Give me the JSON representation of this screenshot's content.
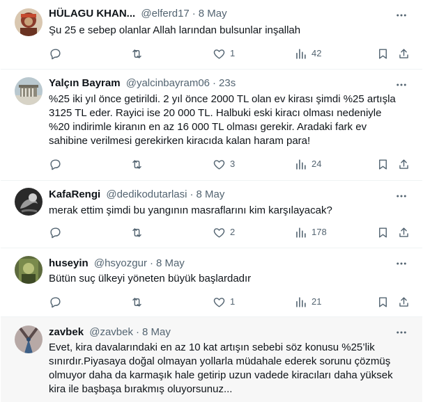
{
  "tweets": [
    {
      "name": "HÜLAGU KHAN...",
      "handle": "@elferd17",
      "time": "8 May",
      "text": "Şu 25 e sebep olanlar Allah larından bulsunlar inşallah",
      "replies": "",
      "retweets": "",
      "likes": "1",
      "views": "42"
    },
    {
      "name": "Yalçın Bayram",
      "handle": "@yalcinbayram06",
      "time": "23s",
      "text": "%25 iki yıl önce getirildi. 2 yıl önce 2000 TL olan ev kirası şimdi %25 artışla 3125 TL eder. Rayici ise 20 000 TL. Halbuki eski kiracı olması nedeniyle %20 indirimle kiranın en az 16 000 TL olması gerekir. Aradaki fark ev sahibine verilmesi gerekirken kiracıda kalan haram para!",
      "replies": "",
      "retweets": "",
      "likes": "3",
      "views": "24"
    },
    {
      "name": "KafaRengi",
      "handle": "@dedikodutarlasi",
      "time": "8 May",
      "text": "merak ettim şimdi bu yangının masraflarını kim karşılayacak?",
      "replies": "",
      "retweets": "",
      "likes": "2",
      "views": "178"
    },
    {
      "name": "huseyin",
      "handle": "@hsyozgur",
      "time": "8 May",
      "text": "Bütün suç ülkeyi yöneten büyük başlardadır",
      "replies": "",
      "retweets": "",
      "likes": "1",
      "views": "21"
    },
    {
      "name": "zavbek",
      "handle": "@zavbek",
      "time": "8 May",
      "text": "Evet, kira davalarındaki en az 10 kat artışın sebebi söz konusu %25’lik sınırdır.Piyasaya doğal olmayan yollarla müdahale ederek sorunu çözmüş olmuyor daha da karmaşık hale getirip uzun vadede kiracıları daha yüksek kira ile başbaşa bırakmış oluyorsunuz..."
    }
  ],
  "colors": {
    "text_primary": "#0f1419",
    "text_secondary": "#536471",
    "divider": "#eff3f4",
    "hover_bg": "#f7f7f7"
  },
  "icons": {
    "reply": "reply-icon",
    "retweet": "retweet-icon",
    "like": "heart-icon",
    "views": "views-icon",
    "bookmark": "bookmark-icon",
    "share": "share-icon",
    "more": "more-icon"
  }
}
